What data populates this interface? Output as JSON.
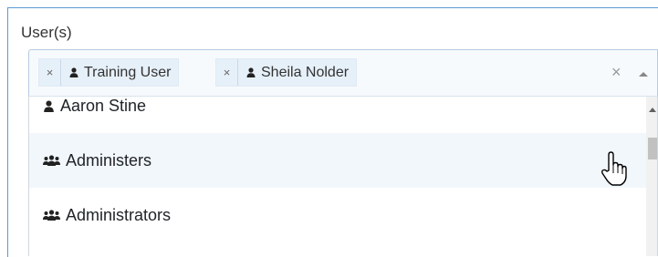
{
  "field": {
    "label": "User(s)"
  },
  "selected_tags": [
    {
      "label": "Training User",
      "remove": "×",
      "icon": "user-icon"
    },
    {
      "label": "Sheila Nolder",
      "remove": "×",
      "icon": "user-icon"
    }
  ],
  "select": {
    "clear": "×",
    "toggle_icon": "caret-up-icon"
  },
  "options": [
    {
      "label": "Aaron Stine",
      "icon": "user-icon"
    },
    {
      "label": "Administers",
      "icon": "group-icon",
      "hovered": true
    },
    {
      "label": "Administrators",
      "icon": "group-icon"
    }
  ],
  "colors": {
    "focus_border": "#5b9bd5",
    "tag_background": "#e6f0f9",
    "hover_background": "#f2f7fb"
  }
}
